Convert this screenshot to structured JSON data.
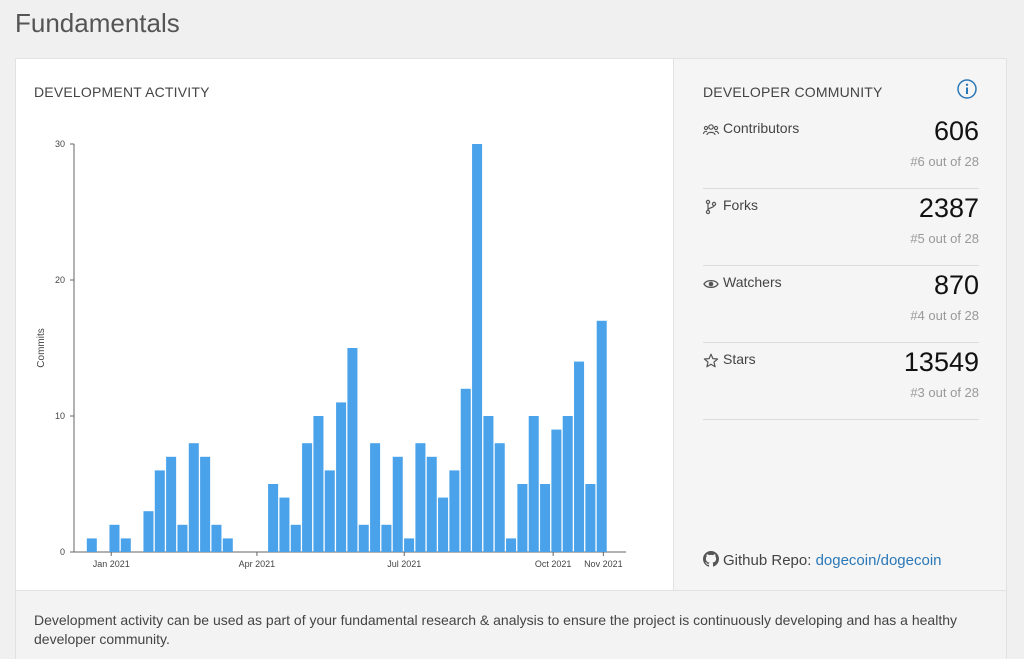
{
  "page": {
    "title": "Fundamentals"
  },
  "dev_activity": {
    "title": "DEVELOPMENT ACTIVITY"
  },
  "chart_data": {
    "type": "bar",
    "ylabel": "Commits",
    "ylim": [
      0,
      30
    ],
    "yticks": [
      0,
      10,
      20,
      30
    ],
    "xlim": [
      "2020-12-09",
      "2021-11-15"
    ],
    "xticks": [
      {
        "date": "2021-01-01",
        "label": "Jan 2021"
      },
      {
        "date": "2021-04-01",
        "label": "Apr 2021"
      },
      {
        "date": "2021-07-01",
        "label": "Jul 2021"
      },
      {
        "date": "2021-10-01",
        "label": "Oct 2021"
      },
      {
        "date": "2021-11-01",
        "label": "Nov 2021"
      }
    ],
    "x": [
      "2020-12-20",
      "2020-12-27",
      "2021-01-03",
      "2021-01-10",
      "2021-01-17",
      "2021-01-24",
      "2021-01-31",
      "2021-02-07",
      "2021-02-14",
      "2021-02-21",
      "2021-02-28",
      "2021-03-07",
      "2021-03-14",
      "2021-03-21",
      "2021-03-28",
      "2021-04-04",
      "2021-04-11",
      "2021-04-18",
      "2021-04-25",
      "2021-05-02",
      "2021-05-09",
      "2021-05-16",
      "2021-05-23",
      "2021-05-30",
      "2021-06-06",
      "2021-06-13",
      "2021-06-20",
      "2021-06-27",
      "2021-07-04",
      "2021-07-11",
      "2021-07-18",
      "2021-07-25",
      "2021-08-01",
      "2021-08-08",
      "2021-08-15",
      "2021-08-22",
      "2021-08-29",
      "2021-09-05",
      "2021-09-12",
      "2021-09-19",
      "2021-09-26",
      "2021-10-03",
      "2021-10-10",
      "2021-10-17",
      "2021-10-24",
      "2021-10-31"
    ],
    "values": [
      1,
      0,
      2,
      1,
      0,
      3,
      6,
      7,
      2,
      8,
      7,
      2,
      1,
      0,
      0,
      0,
      5,
      4,
      2,
      8,
      10,
      6,
      11,
      15,
      2,
      8,
      2,
      7,
      1,
      8,
      7,
      4,
      6,
      12,
      30,
      10,
      8,
      1,
      5,
      10,
      5,
      9,
      10,
      14,
      5,
      17
    ],
    "color": "#4aa3ea"
  },
  "community": {
    "title": "DEVELOPER COMMUNITY",
    "info_icon": "info-icon",
    "metrics": [
      {
        "icon": "contributors-icon",
        "label": "Contributors",
        "value": "606",
        "rank": "#6 out of 28"
      },
      {
        "icon": "fork-icon",
        "label": "Forks",
        "value": "2387",
        "rank": "#5 out of 28"
      },
      {
        "icon": "eye-icon",
        "label": "Watchers",
        "value": "870",
        "rank": "#4 out of 28"
      },
      {
        "icon": "star-icon",
        "label": "Stars",
        "value": "13549",
        "rank": "#3 out of 28"
      }
    ],
    "github": {
      "label": "Github Repo:",
      "link_text": "dogecoin/dogecoin"
    }
  },
  "footer": {
    "text": "Development activity can be used as part of your fundamental research & analysis to ensure the project is continuously developing and has a healthy developer community."
  },
  "colors": {
    "accent": "#2b78b8",
    "bar": "#4aa3ea"
  }
}
